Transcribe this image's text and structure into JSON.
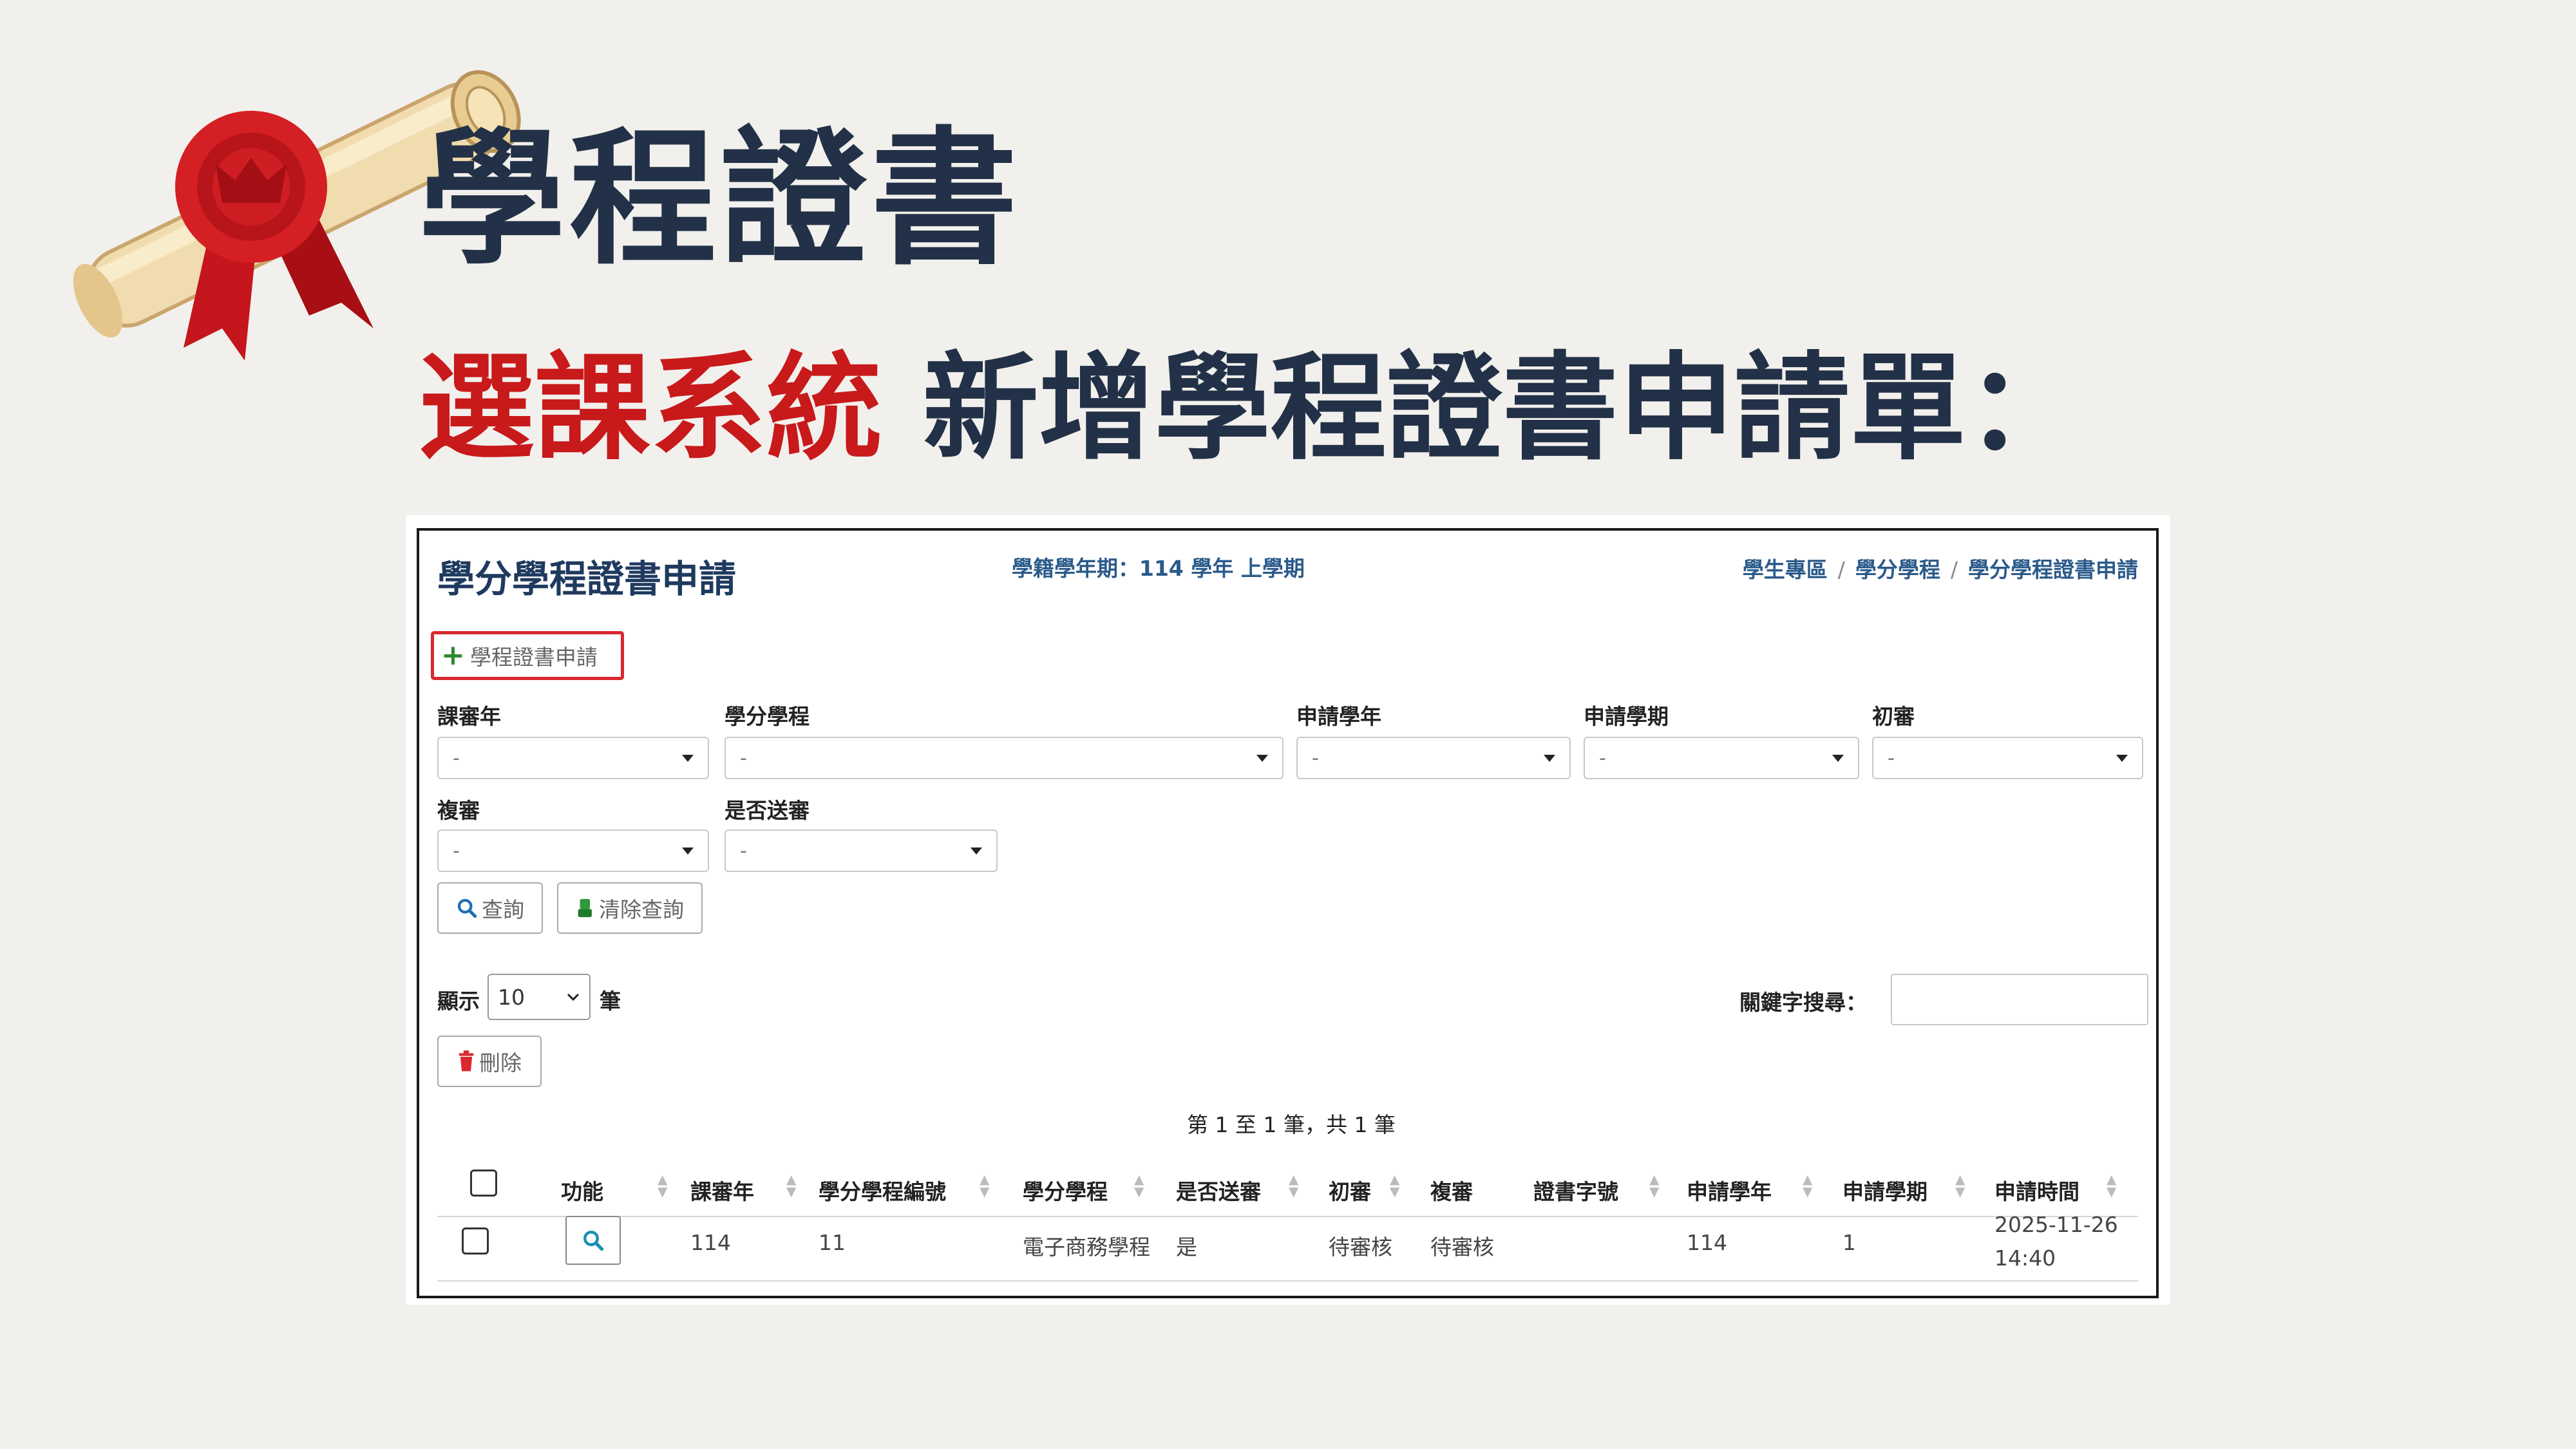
{
  "slide": {
    "title": "學程證書",
    "subtitle_highlight": "選課系統",
    "subtitle_rest": " 新增學程證書申請單："
  },
  "app": {
    "page_title": "學分學程證書申請",
    "semester": "學籍學年期：114 學年 上學期",
    "breadcrumb": [
      "學生專區",
      "學分學程",
      "學分學程證書申請"
    ],
    "add_button": "學程證書申請",
    "filters": {
      "review_year": {
        "label": "課審年",
        "value": "-"
      },
      "program": {
        "label": "學分學程",
        "value": "-"
      },
      "apply_year": {
        "label": "申請學年",
        "value": "-"
      },
      "apply_term": {
        "label": "申請學期",
        "value": "-"
      },
      "first_review": {
        "label": "初審",
        "value": "-"
      },
      "second_review": {
        "label": "複審",
        "value": "-"
      },
      "submitted": {
        "label": "是否送審",
        "value": "-"
      }
    },
    "search_button": "查詢",
    "clear_button": "清除查詢",
    "show_label": "顯示",
    "page_size": "10",
    "show_unit": "筆",
    "keyword_label": "關鍵字搜尋：",
    "delete_button": "刪除",
    "summary": "第 1 至 1 筆，共 1 筆",
    "table": {
      "headers": [
        "功能",
        "課審年",
        "學分學程編號",
        "學分學程",
        "是否送審",
        "初審",
        "複審",
        "證書字號",
        "申請學年",
        "申請學期",
        "申請時間"
      ],
      "rows": [
        {
          "review_year": "114",
          "program_no": "11",
          "program": "電子商務學程",
          "submitted": "是",
          "first_review": "待審核",
          "second_review": "待審核",
          "cert_no": "",
          "apply_year": "114",
          "apply_term": "1",
          "apply_date": "2025-11-26",
          "apply_time": "14:40"
        }
      ]
    }
  },
  "colors": {
    "navy": "#223147",
    "accent_red": "#c8191b",
    "link_blue": "#2a5a8a",
    "highlight_box": "#d9282f"
  },
  "icons": [
    "scroll-seal-icon",
    "plus-icon",
    "search-icon",
    "eraser-icon",
    "trash-icon",
    "sort-icon"
  ]
}
